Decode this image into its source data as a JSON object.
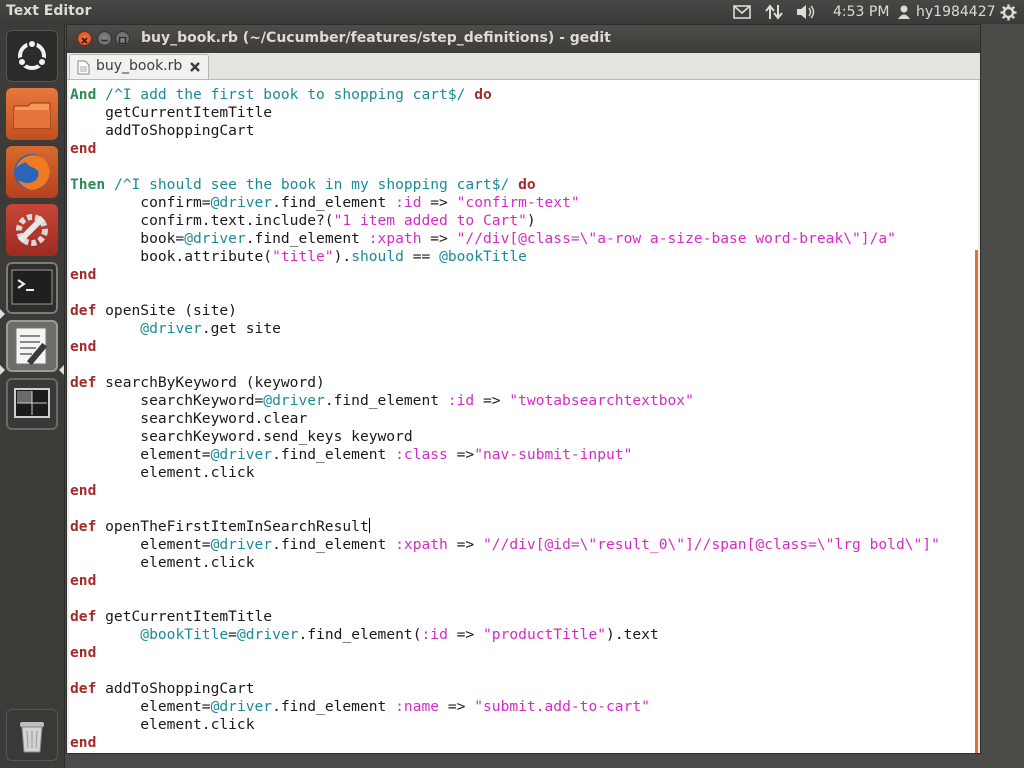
{
  "panel": {
    "app_name": "Text Editor",
    "clock": "4:53 PM",
    "user": "hy1984427",
    "indicators": [
      "mail-icon",
      "network-icon",
      "volume-icon",
      "user-icon",
      "gear-icon"
    ]
  },
  "launcher": {
    "items": [
      "ubuntu-dash",
      "files",
      "firefox",
      "system-settings",
      "terminal",
      "text-editor",
      "workspace-switcher",
      "trash"
    ]
  },
  "window": {
    "title": "buy_book.rb (~/Cucumber/features/step_definitions) - gedit",
    "tab_label": "buy_book.rb"
  },
  "editor": {
    "lines": [
      "And /^I add the first book to shopping cart$/ do",
      "    getCurrentItemTitle",
      "    addToShoppingCart",
      "end",
      "",
      "Then /^I should see the book in my shopping cart$/ do",
      "        confirm=@driver.find_element :id => \"confirm-text\"",
      "        confirm.text.include?(\"1 item added to Cart\")",
      "        book=@driver.find_element :xpath => \"//div[@class=\\\"a-row a-size-base word-break\\\"]/a\"",
      "        book.attribute(\"title\").should == @bookTitle",
      "end",
      "",
      "def openSite (site)",
      "        @driver.get site",
      "end",
      "",
      "def searchByKeyword (keyword)",
      "        searchKeyword=@driver.find_element :id => \"twotabsearchtextbox\"",
      "        searchKeyword.clear",
      "        searchKeyword.send_keys keyword",
      "        element=@driver.find_element :class =>\"nav-submit-input\"",
      "        element.click",
      "end",
      "",
      "def openTheFirstItemInSearchResult",
      "        element=@driver.find_element :xpath => \"//div[@id=\\\"result_0\\\"]//span[@class=\\\"lrg bold\\\"]\"",
      "        element.click",
      "end",
      "",
      "def getCurrentItemTitle",
      "        @bookTitle=@driver.find_element(:id => \"productTitle\").text",
      "end",
      "",
      "def addToShoppingCart",
      "        element=@driver.find_element :name => \"submit.add-to-cart\"",
      "        element.click",
      "end"
    ],
    "cursor_line": 25
  },
  "colors": {
    "keyword": "#a52a2a",
    "step_keyword": "#2e8b57",
    "instance_var": "#1b8a9b",
    "string": "#d62bc6",
    "accent": "#e2702f"
  }
}
